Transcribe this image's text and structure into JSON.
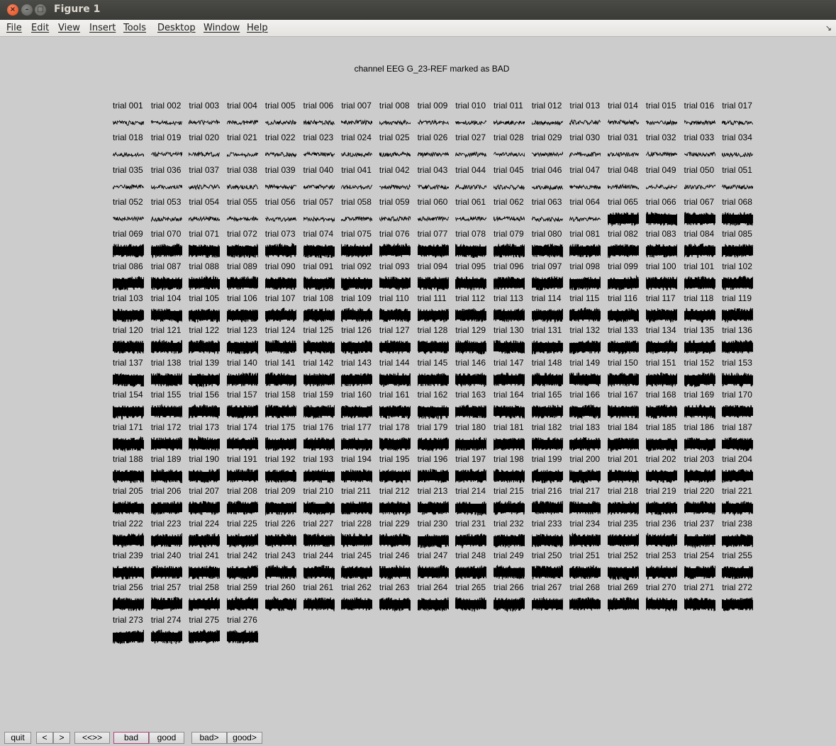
{
  "window": {
    "title": "Figure 1",
    "close_glyph": "×",
    "min_glyph": "–",
    "max_glyph": "□"
  },
  "menubar": {
    "items": [
      "File",
      "Edit",
      "View",
      "Insert",
      "Tools",
      "Desktop",
      "Window",
      "Help"
    ],
    "arrow_icon": "↘"
  },
  "figure": {
    "title": "channel EEG G_23-REF marked as BAD",
    "trial_prefix": "trial",
    "trial_count": 276,
    "columns": 17
  },
  "buttons": {
    "quit": "quit",
    "prev": "<",
    "next": ">",
    "first_last": "<<>>",
    "bad": "bad",
    "good": "good",
    "next_bad": "bad>",
    "next_good": "good>"
  }
}
